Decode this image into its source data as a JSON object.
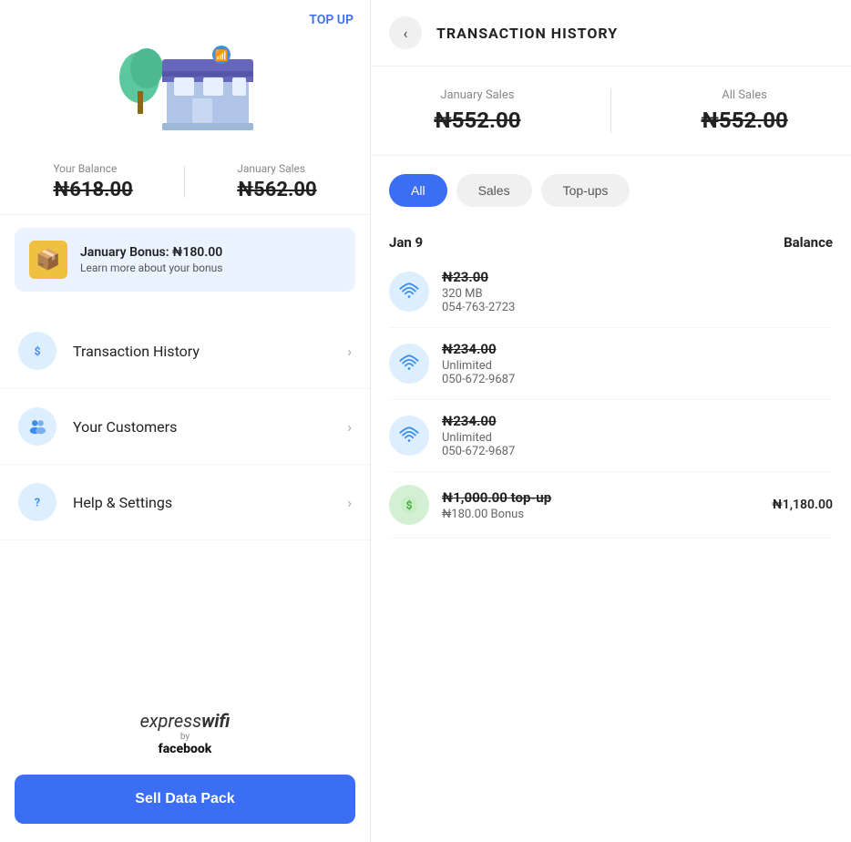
{
  "left": {
    "topup_label": "TOP UP",
    "balance": {
      "label": "Your Balance",
      "value": "₦618.00"
    },
    "january_sales": {
      "label": "January Sales",
      "value": "₦562.00"
    },
    "bonus": {
      "title": "January Bonus: ₦180.00",
      "subtitle": "Learn more about your bonus"
    },
    "menu": [
      {
        "id": "transaction-history",
        "label": "Transaction History",
        "icon": "dollar"
      },
      {
        "id": "your-customers",
        "label": "Your Customers",
        "icon": "people"
      },
      {
        "id": "help-settings",
        "label": "Help & Settings",
        "icon": "question"
      }
    ],
    "brand": {
      "line1": "expresswifi",
      "by": "by",
      "line2": "facebook"
    },
    "sell_btn": "Sell Data Pack"
  },
  "right": {
    "title": "TRANSACTION HISTORY",
    "back_label": "‹",
    "january_sales": {
      "label": "January Sales",
      "value": "₦552.00"
    },
    "all_sales": {
      "label": "All Sales",
      "value": "₦552.00"
    },
    "filters": [
      {
        "id": "all",
        "label": "All",
        "active": true
      },
      {
        "id": "sales",
        "label": "Sales",
        "active": false
      },
      {
        "id": "topups",
        "label": "Top-ups",
        "active": false
      }
    ],
    "date_section": {
      "date": "Jan 9",
      "balance_col": "Balance"
    },
    "transactions": [
      {
        "id": "tx1",
        "amount": "₦23.00",
        "desc": "320 MB",
        "phone": "054-763-2723",
        "balance": "",
        "type": "wifi"
      },
      {
        "id": "tx2",
        "amount": "₦234.00",
        "desc": "Unlimited",
        "phone": "050-672-9687",
        "balance": "",
        "type": "wifi"
      },
      {
        "id": "tx3",
        "amount": "₦234.00",
        "desc": "Unlimited",
        "phone": "050-672-9687",
        "balance": "",
        "type": "wifi"
      },
      {
        "id": "tx4",
        "amount": "₦1,000.00 top-up",
        "desc": "₦180.00 Bonus",
        "phone": "",
        "balance": "₦1,180.00",
        "type": "dollar"
      }
    ]
  }
}
